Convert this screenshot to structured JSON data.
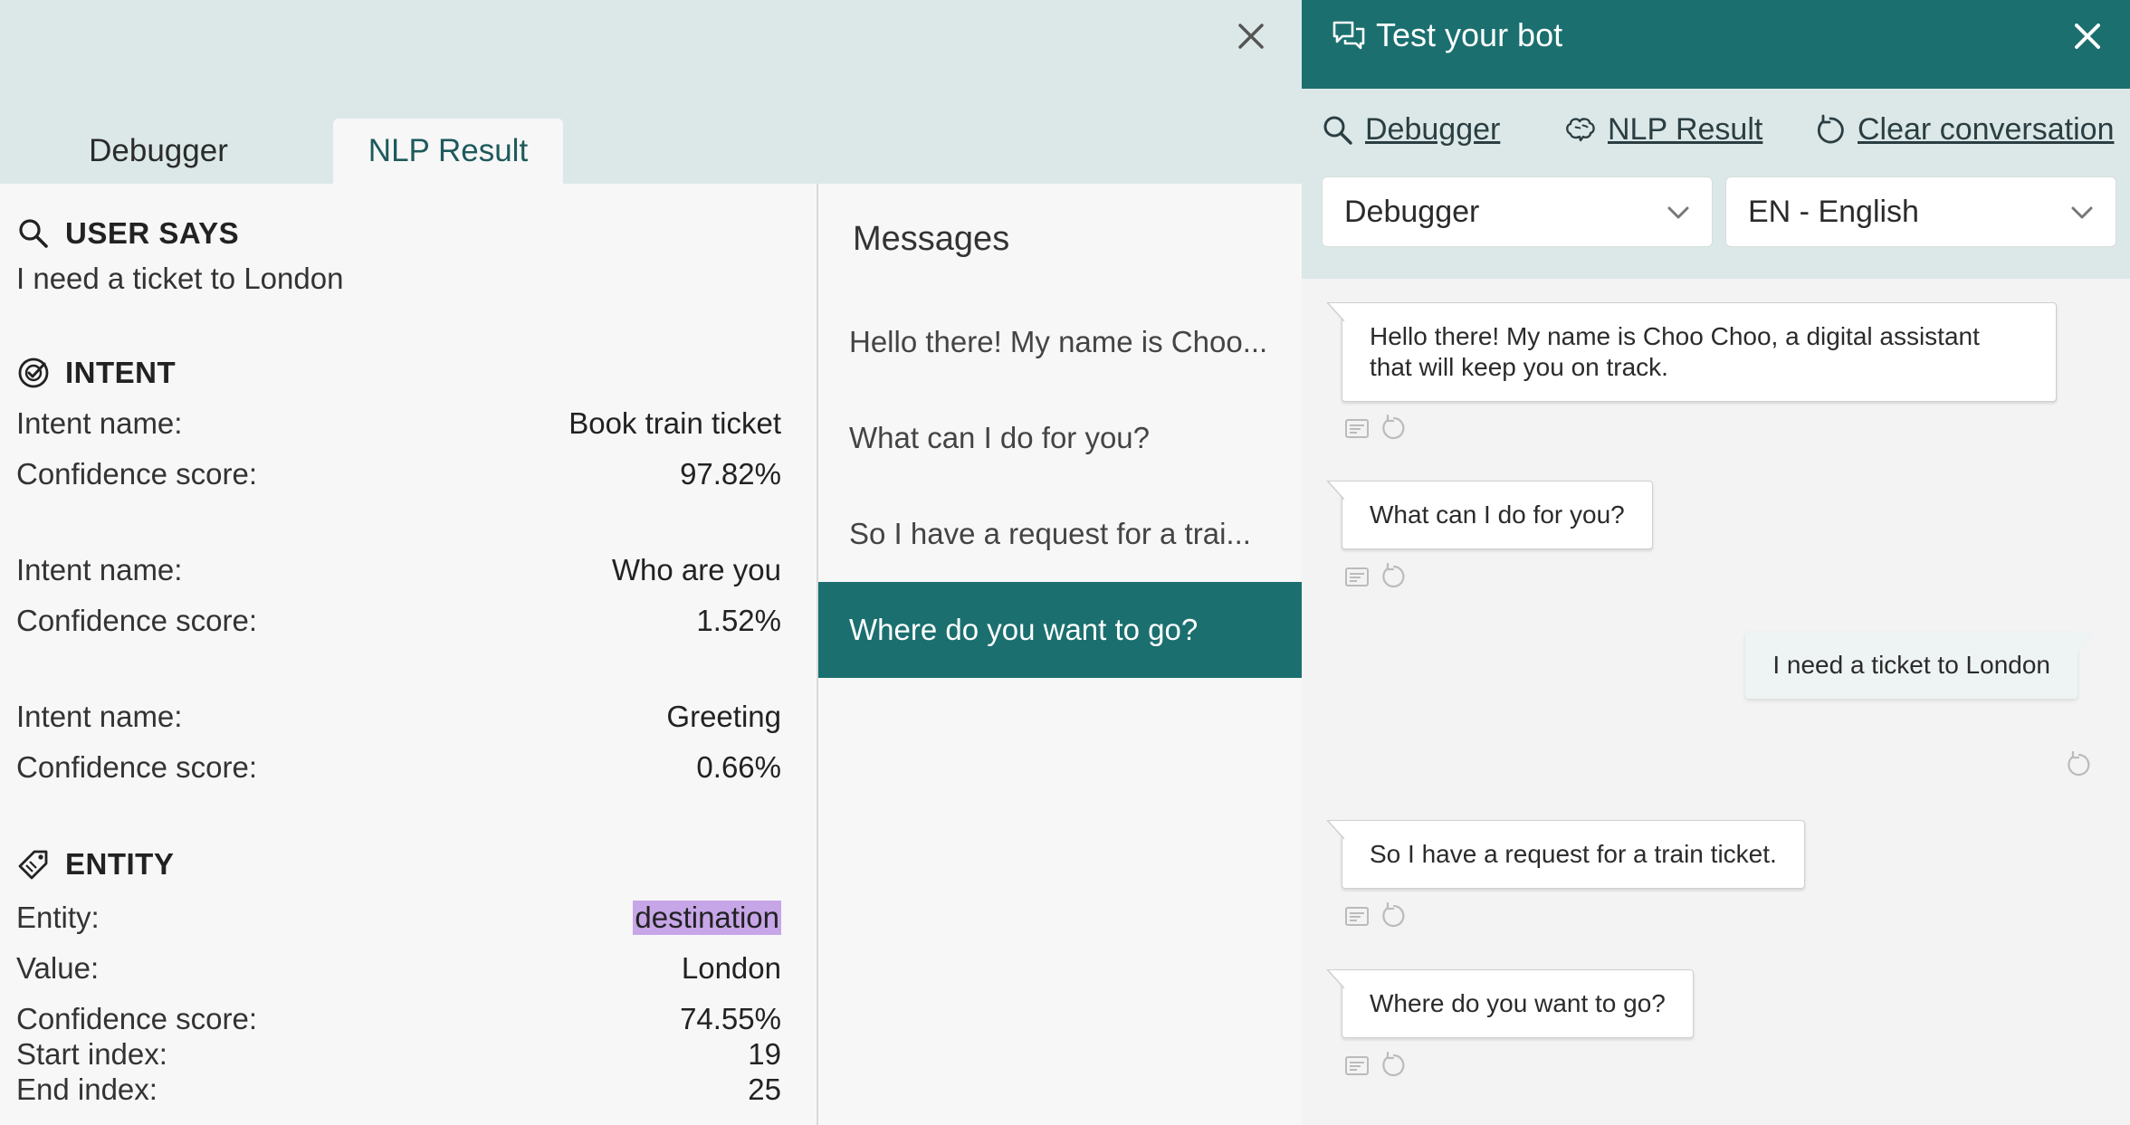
{
  "left": {
    "tabs": [
      {
        "label": "Debugger"
      },
      {
        "label": "NLP Result"
      }
    ],
    "user_says": {
      "heading": "USER SAYS",
      "text": "I need a ticket to London"
    },
    "intent": {
      "heading": "INTENT",
      "items": [
        {
          "name_label": "Intent name:",
          "name": "Book train ticket",
          "score_label": "Confidence score:",
          "score": "97.82%"
        },
        {
          "name_label": "Intent name:",
          "name": "Who are you",
          "score_label": "Confidence score:",
          "score": "1.52%"
        },
        {
          "name_label": "Intent name:",
          "name": "Greeting",
          "score_label": "Confidence score:",
          "score": "0.66%"
        }
      ]
    },
    "entity": {
      "heading": "ENTITY",
      "entity_label": "Entity:",
      "entity": "destination",
      "value_label": "Value:",
      "value": "London",
      "score_label": "Confidence score:",
      "score": "74.55%",
      "start_label": "Start index:",
      "start": "19",
      "end_label": "End index:",
      "end": "25",
      "highlight_color": "#c7a6e8"
    },
    "messages": {
      "title": "Messages",
      "items": [
        {
          "text": "Hello there! My name is Choo..."
        },
        {
          "text": "What can I do for you?"
        },
        {
          "text": "So I have a request for a trai..."
        },
        {
          "text": "Where do you want to go?"
        }
      ],
      "active_index": 3
    }
  },
  "right": {
    "title": "Test your bot",
    "links": {
      "debugger": "Debugger",
      "nlp": "NLP Result",
      "clear": "Clear conversation"
    },
    "mode_select": {
      "value": "Debugger"
    },
    "lang_select": {
      "value": "EN - English"
    },
    "chat": [
      {
        "from": "bot",
        "text": "Hello there! My name is Choo Choo, a digital assistant that will keep you on track."
      },
      {
        "from": "bot",
        "text": "What can I do for you?"
      },
      {
        "from": "user",
        "text": "I need a ticket to London"
      },
      {
        "from": "bot",
        "text": "So I have a request for a train ticket."
      },
      {
        "from": "bot",
        "text": "Where do you want to go?"
      }
    ]
  },
  "colors": {
    "accent": "#1b6f6f",
    "header_bg": "#dce8e8",
    "panel_bg": "#f7f7f7"
  }
}
